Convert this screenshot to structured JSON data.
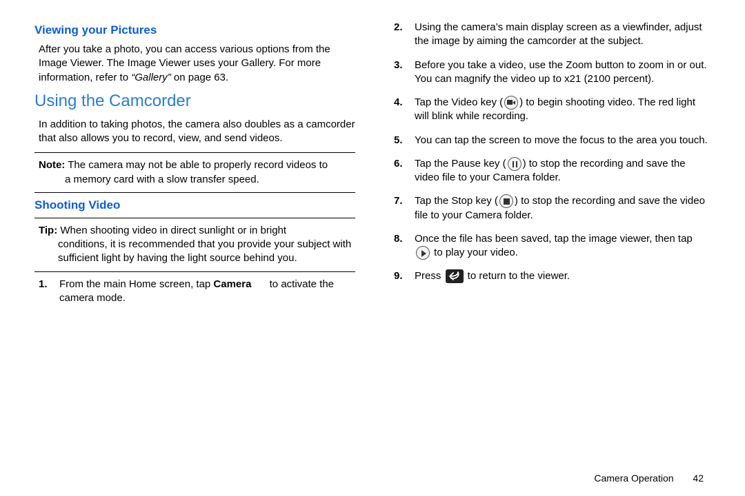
{
  "left": {
    "h_viewing": "Viewing your Pictures",
    "viewing_p_a": "After you take a photo, you can access various options from the Image Viewer. The Image Viewer uses your Gallery. For more information, refer to ",
    "viewing_p_ref": "“Gallery”",
    "viewing_p_b": "  on page 63.",
    "h_using": "Using the Camcorder",
    "using_p": "In addition to taking photos, the camera also doubles as a camcorder that also allows you to record, view, and send videos.",
    "note_label": "Note:",
    "note_first": " The camera may not be able to properly record videos to",
    "note_rest": "a memory card with a slow transfer speed.",
    "h_shooting": "Shooting Video",
    "tip_label": "Tip:",
    "tip_first": " When shooting video in direct sunlight or in bright",
    "tip_rest": "conditions, it is recommended that you provide your subject with sufficient light by having the light source behind you.",
    "step1_a": "From the main Home screen, tap ",
    "step1_bold": "Camera",
    "step1_b": " to activate the camera mode."
  },
  "right": {
    "s2": "Using the camera’s main display screen as a viewfinder, adjust the image by aiming the camcorder at the subject.",
    "s3": "Before you take a video, use the Zoom button to zoom in or out. You can magnify the video up to x21 (2100 percent).",
    "s4_a": "Tap the Video key (",
    "s4_b": ") to begin shooting video. The red light will blink while recording.",
    "s5": "You can tap the screen to move the focus to the area you touch.",
    "s6_a": "Tap the Pause key (",
    "s6_b": ") to stop the recording and save the video file to your Camera folder.",
    "s7_a": "Tap the Stop key (",
    "s7_b": ") to stop the recording and save the video file to your Camera folder.",
    "s8_a": "Once the file has been saved, tap the image viewer, then tap ",
    "s8_b": " to play your video.",
    "s9_a": "Press ",
    "s9_b": " to return to the viewer."
  },
  "footer": {
    "section": "Camera Operation",
    "page": "42"
  }
}
